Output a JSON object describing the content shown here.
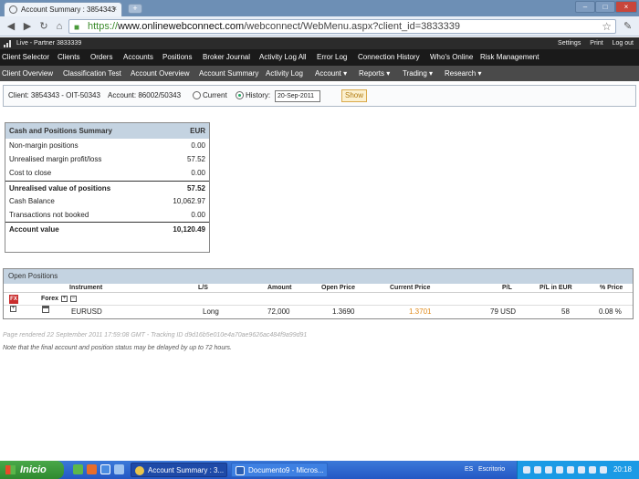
{
  "browser": {
    "tab_title": "Account Summary : 3854343",
    "url_scheme": "https://",
    "url_domain": "www.onlinewebconnect.com",
    "url_path": "/webconnect/WebMenu.aspx?client_id=3833339"
  },
  "app_header": {
    "partner": "Live - Partner 3833339",
    "links": [
      "Settings",
      "Print",
      "Log out"
    ]
  },
  "main_nav": [
    "Client Selector",
    "Clients",
    "Orders",
    "Accounts",
    "Positions",
    "Broker Journal",
    "Activity Log All",
    "Error Log",
    "Connection History",
    "Who's Online",
    "Risk Management"
  ],
  "sub_nav": [
    "Client Overview",
    "Classification Test",
    "Account Overview",
    "Account Summary",
    "Activity Log",
    "Account ▾",
    "Reports ▾",
    "Trading ▾",
    "Research ▾"
  ],
  "client_bar": {
    "client": "Client: 3854343 - OIT-50343",
    "account": "Account: 86002/50343",
    "current_label": "Current",
    "history_label": "History:",
    "date": "20-Sep-2011",
    "show_label": "Show"
  },
  "cash_summary": {
    "title": "Cash and Positions Summary",
    "currency": "EUR",
    "rows": [
      {
        "label": "Non-margin positions",
        "value": "0.00"
      },
      {
        "label": "Unrealised margin profit/loss",
        "value": "57.52"
      },
      {
        "label": "Cost to close",
        "value": "0.00"
      },
      {
        "label": "Unrealised value of positions",
        "value": "57.52"
      },
      {
        "label": "Cash Balance",
        "value": "10,062.97"
      },
      {
        "label": "Transactions not booked",
        "value": "0.00"
      },
      {
        "label": "Account value",
        "value": "10,120.49"
      }
    ]
  },
  "open_positions": {
    "title": "Open Positions",
    "columns": [
      "Instrument",
      "L/S",
      "Amount",
      "Open Price",
      "Current Price",
      "P/L",
      "P/L in EUR",
      "% Price"
    ],
    "group_icon": "FX",
    "group_label": "Forex",
    "row": {
      "instrument": "EURUSD",
      "ls": "Long",
      "amount": "72,000",
      "open_price": "1.3690",
      "current_price": "1.3701",
      "pl": "79 USD",
      "pl_eur": "58",
      "pct_price": "0.08 %"
    }
  },
  "footnotes": {
    "rendered": "Page rendered 22 September 2011 17:59:08 GMT - Tracking ID d9d16b5e010e4a70ae9626ac484f9a99d91",
    "note": "Note that the final account and position status may be delayed by up to 72 hours."
  },
  "taskbar": {
    "start": "Inicio",
    "buttons": [
      "Account Summary : 3...",
      "Documento9 - Micros..."
    ],
    "lang": "ES",
    "desktop": "Escritorio",
    "clock": "20:18"
  },
  "colors": {
    "accent_header": "#c4d3e1",
    "nav_dark": "#1a1a1a",
    "current_price": "#e08a1a"
  }
}
